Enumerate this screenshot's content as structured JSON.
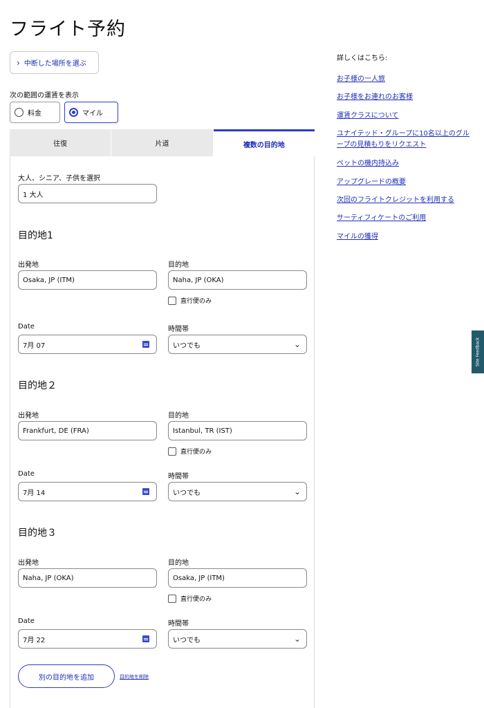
{
  "page": {
    "title": "フライト予約"
  },
  "resume": {
    "icon": "chevron-right-icon",
    "label": "中断した場所を選ぶ"
  },
  "fare_toggle": {
    "label": "次の範囲の運賃を表示",
    "options": [
      {
        "label": "料金",
        "selected": false
      },
      {
        "label": "マイル",
        "selected": true
      }
    ]
  },
  "tabs": [
    {
      "label": "往復",
      "active": false
    },
    {
      "label": "片道",
      "active": false
    },
    {
      "label": "複数の目的地",
      "active": true
    }
  ],
  "passengers": {
    "label": "大人、シニア、子供を選択",
    "value": "1 大人"
  },
  "segments": [
    {
      "heading": "目的地1",
      "origin_label": "出発地",
      "origin": "Osaka, JP (ITM)",
      "dest_label": "目的地",
      "dest": "Naha, JP (OKA)",
      "nonstop": "直行便のみ",
      "date_label": "Date",
      "date": "7月 07",
      "time_label": "時間帯",
      "time": "いつでも"
    },
    {
      "heading": "目的地２",
      "origin_label": "出発地",
      "origin": "Frankfurt, DE (FRA)",
      "dest_label": "目的地",
      "dest": "Istanbul, TR (IST)",
      "nonstop": "直行便のみ",
      "date_label": "Date",
      "date": "7月 14",
      "time_label": "時間帯",
      "time": "いつでも"
    },
    {
      "heading": "目的地３",
      "origin_label": "出発地",
      "origin": "Naha, JP (OKA)",
      "dest_label": "目的地",
      "dest": "Osaka, JP (ITM)",
      "nonstop": "直行便のみ",
      "date_label": "Date",
      "date": "7月 22",
      "time_label": "時間帯",
      "time": "いつでも"
    }
  ],
  "actions": {
    "add": "別の目的地を追加",
    "remove": "目的地を削除"
  },
  "more_info": {
    "heading": "詳しくはこちら:",
    "links": [
      "お子様の一人旅",
      "お子様をお連れのお客様",
      "運賃クラスについて",
      "ユナイテッド・グループに10名以上のグループの見積もりをリクエスト",
      "ペットの機内持込み",
      "アップグレードの概要",
      "次回のフライトクレジットを利用する",
      "サーティフィケートのご利用",
      "マイルの獲得"
    ]
  },
  "feedback": {
    "label": "Site Feedback"
  },
  "colors": {
    "accent": "#2b3ccc",
    "link": "#1c2fb8",
    "tab_bg": "#e9e9e9",
    "feedback_bg": "#235a6b"
  }
}
